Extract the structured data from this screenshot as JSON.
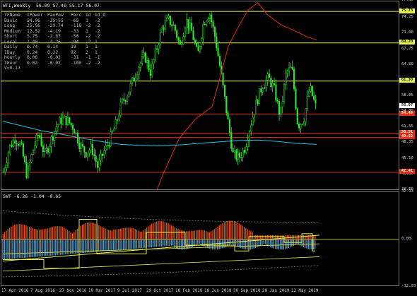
{
  "main_title": "WTI,Weekly  56.09 57.40 55.17 56.07",
  "sub_title": "SWT -6.26 -1.04 -0.65",
  "table": {
    "headers": [
      "TFName",
      "IPower",
      "PanPow",
      "Perc",
      "Id",
      "Id_D"
    ],
    "rows": [
      [
        "Basic",
        "54.96",
        "-35.55",
        "-65",
        "1",
        "-2"
      ],
      [
        "Long",
        "25.56",
        "-29.74",
        "-116",
        "-2",
        "-2"
      ],
      [
        "Medium",
        "12.52",
        "-4.19",
        "-33",
        "1",
        "-2"
      ],
      [
        "Short",
        "5.75",
        "-2.87",
        "-50",
        "-2",
        "-2"
      ],
      [
        "Local",
        "2.40",
        "-2.26",
        "-94",
        "-2",
        "1"
      ],
      [
        "Daily",
        "0.74",
        "0.14",
        "19",
        "1",
        "1"
      ],
      [
        "IDay",
        "0.24",
        "0.22",
        "92",
        "2",
        "1"
      ],
      [
        "Hourly",
        "0.06",
        "-0.02",
        "-31",
        "-1",
        "-1"
      ],
      [
        "IHour",
        "0.02",
        "-0.02",
        "-100",
        "-2",
        "-2"
      ]
    ],
    "footer": "V=0.13"
  },
  "main_axis": [
    "77.80",
    "74.25",
    "71.00",
    "67.75",
    "64.50",
    "61.25",
    "58.05",
    "54.80",
    "51.55",
    "48.35",
    "45.10",
    "41.85",
    "38.60"
  ],
  "sub_axis": [
    "32.93",
    "0.00",
    "-32.93"
  ],
  "level_tags": [
    {
      "label": "75.73",
      "fg": "#000000",
      "bg": "#e8f04a"
    },
    {
      "label": "69.20",
      "fg": "#000000",
      "bg": "#e8f04a"
    },
    {
      "label": "61.30",
      "fg": "#000000",
      "bg": "#e8f04a"
    },
    {
      "label": "56.07",
      "fg": "#000000",
      "bg": "#ffffff"
    },
    {
      "label": "54.49",
      "fg": "#ffffff",
      "bg": "#e03010"
    },
    {
      "label": "50.51",
      "fg": "#ffffff",
      "bg": "#e03010"
    },
    {
      "label": "49.62",
      "fg": "#ffffff",
      "bg": "#e03010"
    },
    {
      "label": "42.41",
      "fg": "#ffffff",
      "bg": "#e03010"
    }
  ],
  "x_labels": [
    "17 Apr 2016",
    "7 Aug 2016",
    "27 Nov 2016",
    "19 Mar 2017",
    "9 Jul 2017",
    "29 Oct 2017",
    "18 Feb 2018",
    "10 Jun 2018",
    "30 Sep 2018",
    "20 Jan 2019",
    "12 May 2019"
  ],
  "chart_data": [
    {
      "type": "candlestick",
      "symbol": "WTI",
      "timeframe": "Weekly",
      "ohlc_last": {
        "open": 56.09,
        "high": 57.4,
        "low": 55.17,
        "close": 56.07
      },
      "ylim": [
        38.6,
        77.8
      ],
      "x_categories": [
        "17 Apr 2016",
        "7 Aug 2016",
        "27 Nov 2016",
        "19 Mar 2017",
        "9 Jul 2017",
        "29 Oct 2017",
        "18 Feb 2018",
        "10 Jun 2018",
        "30 Sep 2018",
        "20 Jan 2019",
        "12 May 2019"
      ],
      "close_path": [
        42.5,
        47.5,
        49.5,
        47.8,
        41.8,
        47.0,
        50.5,
        46.0,
        48.8,
        52.0,
        53.5,
        53.0,
        51.5,
        48.0,
        46.5,
        47.5,
        43.5,
        46.5,
        49.0,
        52.0,
        56.5,
        58.5,
        61.5,
        64.5,
        66.5,
        63.0,
        68.0,
        72.5,
        74.0,
        72.5,
        68.5,
        74.0,
        71.5,
        66.5,
        73.5,
        75.5,
        70.0,
        62.5,
        54.0,
        46.0,
        45.5,
        47.5,
        52.5,
        57.0,
        60.5,
        62.0,
        59.5,
        54.0,
        63.0,
        64.0,
        52.0,
        53.5,
        60.0,
        56.07
      ],
      "horizontal_levels": [
        75.73,
        69.2,
        61.3,
        54.49,
        50.51,
        49.62,
        42.41
      ],
      "ma_series": [
        {
          "color": "#e03010",
          "points": [
            [
              36,
              31.0
            ],
            [
              45,
              35.0
            ],
            [
              49,
              42.0
            ],
            [
              54,
              49.5
            ],
            [
              59,
              53.5
            ],
            [
              62,
              55.0
            ],
            [
              64,
              56.0
            ],
            [
              66,
              61.0
            ],
            [
              69,
              68.5
            ],
            [
              72,
              72.5
            ],
            [
              75,
              76.0
            ],
            [
              78,
              77.5
            ],
            [
              81,
              75.0
            ],
            [
              85,
              73.0
            ],
            [
              90,
              71.5
            ],
            [
              93,
              70.5
            ],
            [
              96,
              69.8
            ]
          ]
        },
        {
          "color": "#20c8d8",
          "points": [
            [
              0,
              53.0
            ],
            [
              6,
              52.0
            ],
            [
              12,
              51.0
            ],
            [
              18,
              50.3
            ],
            [
              24,
              49.5
            ],
            [
              30,
              48.8
            ],
            [
              36,
              48.2
            ],
            [
              42,
              48.0
            ],
            [
              48,
              47.9
            ],
            [
              54,
              48.1
            ],
            [
              60,
              48.4
            ],
            [
              66,
              48.7
            ],
            [
              72,
              49.0
            ],
            [
              78,
              49.1
            ],
            [
              84,
              48.8
            ],
            [
              90,
              48.4
            ],
            [
              96,
              48.2
            ]
          ]
        }
      ]
    },
    {
      "type": "oscillator",
      "name": "SWT",
      "values_last": [
        -6.26,
        -1.04,
        -0.65
      ],
      "ylim": [
        -32.93,
        32.93
      ]
    }
  ]
}
